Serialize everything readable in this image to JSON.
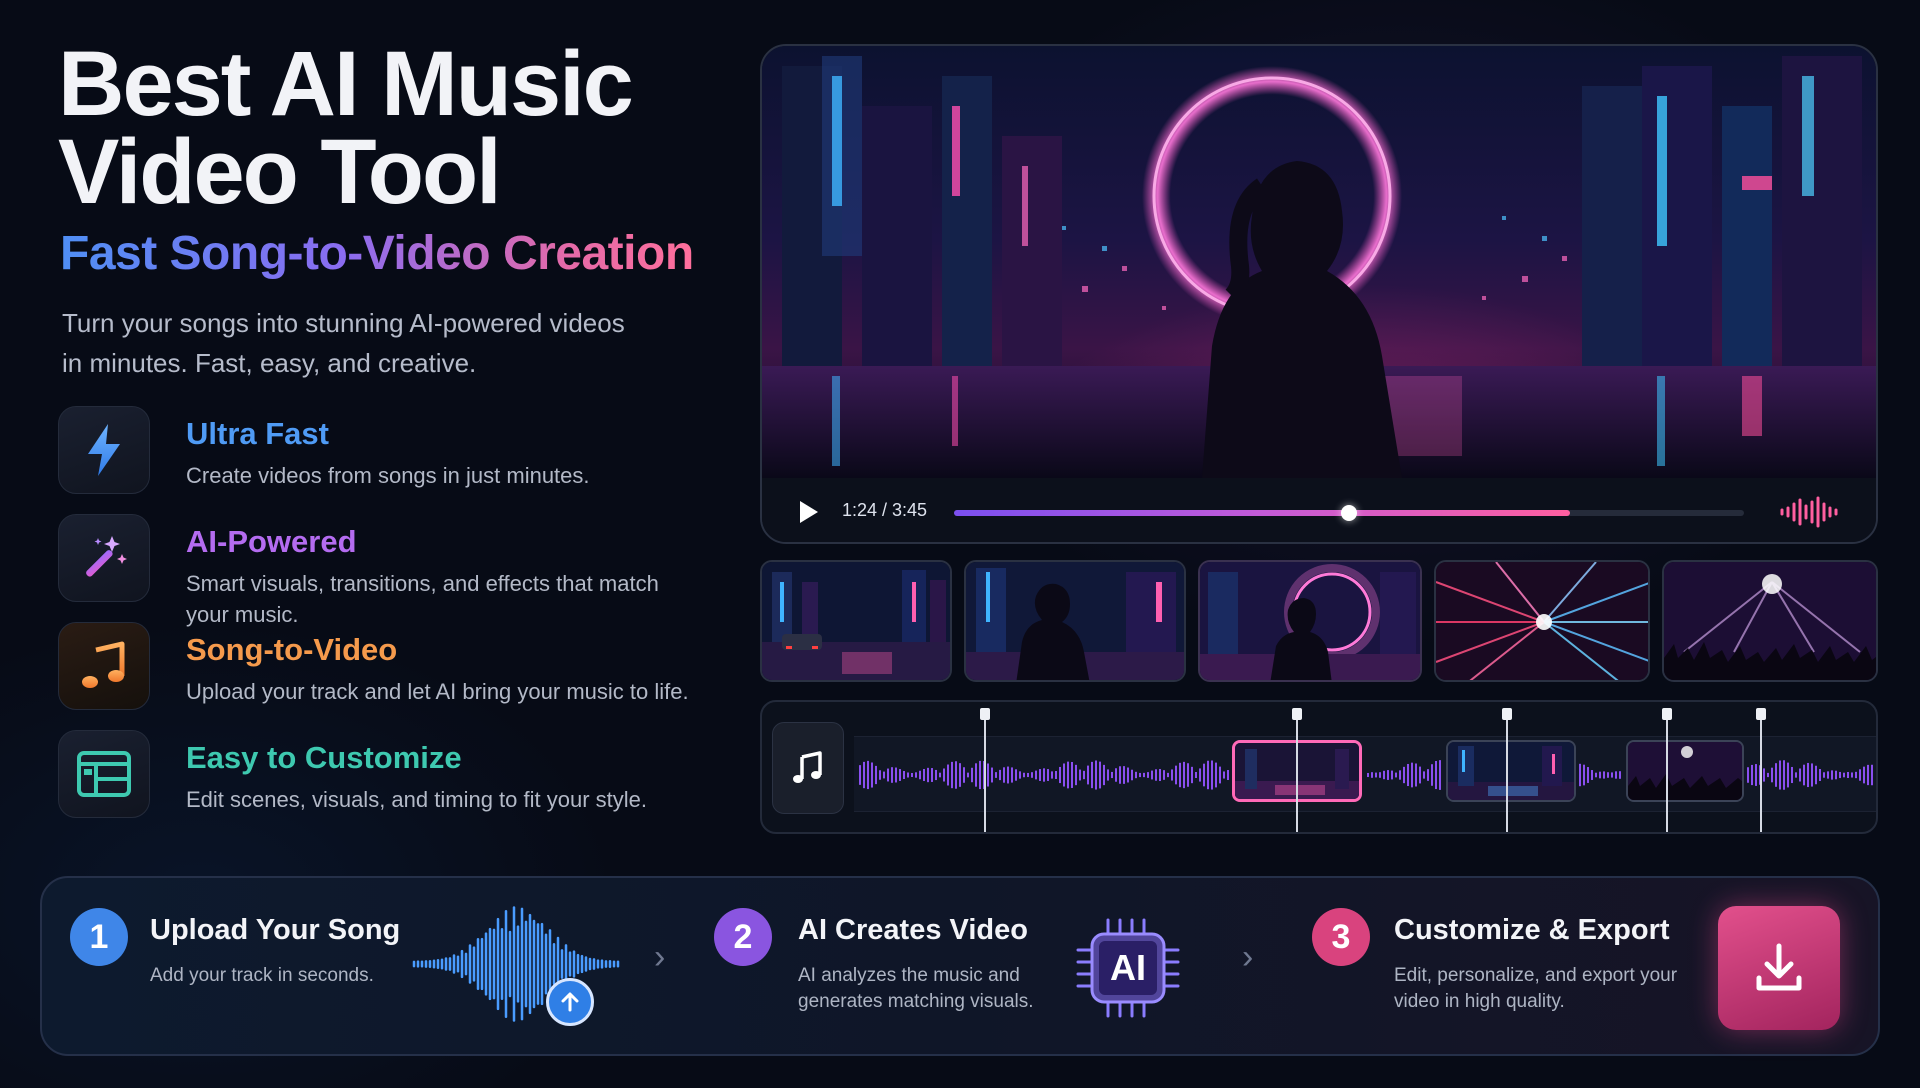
{
  "hero": {
    "title_line1": "Best AI Music",
    "title_line2": "Video Tool",
    "subtitle": "Fast Song-to-Video Creation",
    "description_line1": "Turn your songs into stunning AI-powered videos",
    "description_line2": "in minutes. Fast, easy, and creative."
  },
  "features": [
    {
      "title": "Ultra Fast",
      "desc": "Create videos from songs in just minutes.",
      "color": "#4f9bf5",
      "icon": "lightning-icon"
    },
    {
      "title": "AI-Powered",
      "desc": "Smart visuals, transitions, and effects that match your music.",
      "color": "#b46cf0",
      "icon": "magic-wand-icon"
    },
    {
      "title": "Song-to-Video",
      "desc": "Upload your track and let AI bring your music to life.",
      "color": "#f59a4c",
      "icon": "music-note-icon"
    },
    {
      "title": "Easy to Customize",
      "desc": "Edit scenes, visuals, and timing to fit your style.",
      "color": "#3ec9b0",
      "icon": "layout-icon"
    }
  ],
  "player": {
    "time": "1:24 / 3:45",
    "progress": 0.5,
    "buffered": 0.78
  },
  "steps": [
    {
      "num": "1",
      "title": "Upload Your Song",
      "desc": "Add your track in seconds.",
      "color": "#3f86e8"
    },
    {
      "num": "2",
      "title": "AI Creates Video",
      "desc": "AI analyzes the music and generates matching visuals.",
      "color": "#8a55e0"
    },
    {
      "num": "3",
      "title": "Customize & Export",
      "desc": "Edit, personalize, and export your video in high quality.",
      "color": "#d9437e"
    }
  ],
  "ai_chip_label": "AI",
  "colors": {
    "accent_purple": "#8b5cf6",
    "accent_pink": "#ff5fa0",
    "accent_blue": "#4f9bf5"
  }
}
